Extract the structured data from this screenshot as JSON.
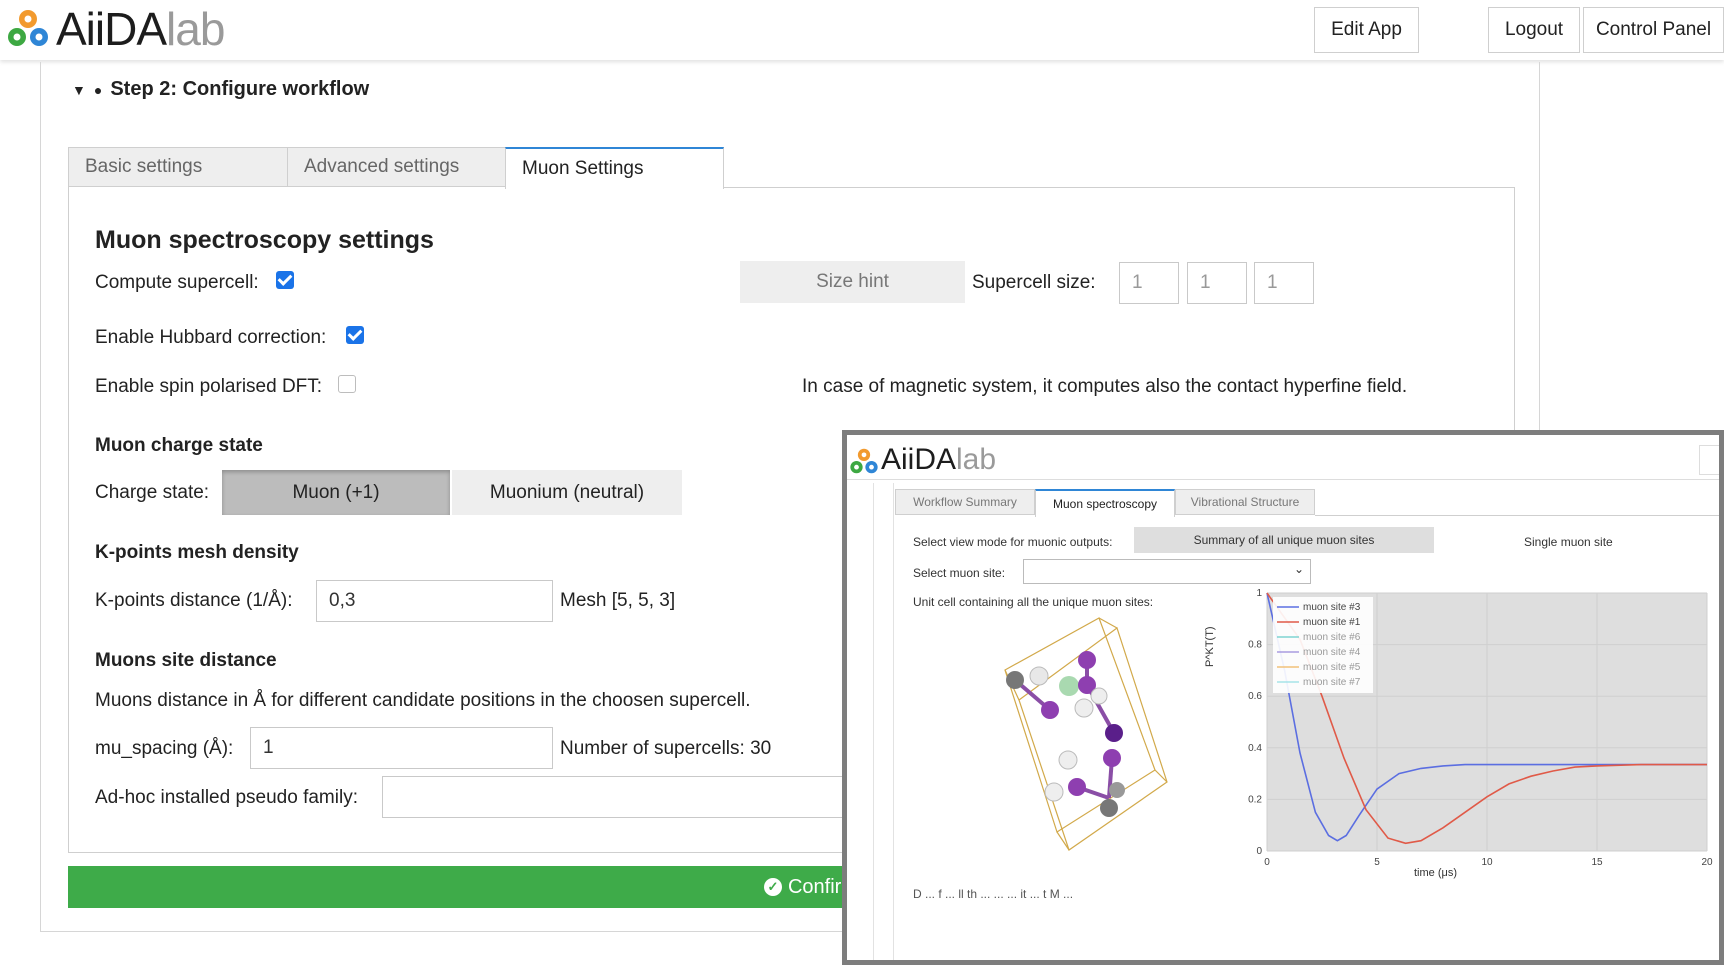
{
  "header": {
    "app_name_main": "AiiDA",
    "app_name_suffix": "lab",
    "buttons": {
      "edit_app": "Edit App",
      "logout": "Logout",
      "control_panel": "Control Panel"
    }
  },
  "step": {
    "title": "Step 2: Configure workflow"
  },
  "tabs": [
    "Basic settings",
    "Advanced settings",
    "Muon Settings"
  ],
  "muon_settings": {
    "section_title": "Muon spectroscopy settings",
    "compute_supercell_label": "Compute supercell:",
    "compute_supercell_checked": true,
    "size_hint_label": "Size hint",
    "supercell_size_label": "Supercell size:",
    "supercell_size": [
      "1",
      "1",
      "1"
    ],
    "hubbard_label": "Enable Hubbard correction:",
    "hubbard_checked": true,
    "spin_label": "Enable spin polarised DFT:",
    "spin_checked": false,
    "spin_note": "In case of magnetic system, it computes also the contact hyperfine field.",
    "charge_title": "Muon charge state",
    "charge_label": "Charge state:",
    "charge_options": [
      "Muon (+1)",
      "Muonium (neutral)"
    ],
    "charge_selected": "Muon (+1)",
    "kpoints_title": "K-points mesh density",
    "kpoints_label": "K-points distance (1/Å):",
    "kpoints_value": "0,3",
    "mesh_text": "Mesh [5, 5, 3]",
    "sites_title": "Muons site distance",
    "sites_desc": "Muons distance in Å for different candidate positions in the choosen supercell.",
    "spacing_label": "mu_spacing (Å):",
    "spacing_value": "1",
    "num_supercells": "Number of supercells: 30",
    "pseudo_label": "Ad-hoc installed pseudo family:",
    "pseudo_value": ""
  },
  "confirm_label": "Confirm",
  "colors": {
    "accent_blue": "#2f86d6",
    "confirm_green": "#3eab49",
    "checkbox_blue": "#1a73e8"
  },
  "results": {
    "app_name_main": "AiiDA",
    "app_name_suffix": "lab",
    "tabs": [
      "Workflow Summary",
      "Muon spectroscopy",
      "Vibrational Structure"
    ],
    "active_tab": "Muon spectroscopy",
    "view_mode_label": "Select view mode for muonic outputs:",
    "view_modes": [
      "Summary of all unique muon sites",
      "Single muon site"
    ],
    "muon_site_label": "Select muon site:",
    "muon_site_value": "",
    "unit_cell_label": "Unit cell containing all the unique muon sites:",
    "bottom_text": "D ... f ... ll th ... ... ... it ... t M ..."
  },
  "chart_data": {
    "type": "line",
    "xlabel": "time (μs)",
    "ylabel": "P^KT(T)",
    "xlim": [
      0,
      20
    ],
    "ylim": [
      0,
      1
    ],
    "xticks": [
      0,
      5,
      10,
      15,
      20
    ],
    "yticks": [
      0,
      0.2,
      0.4,
      0.6,
      0.8,
      1
    ],
    "legend_position": "top-left",
    "series": [
      {
        "name": "muon site #3",
        "color": "#5b6ee1",
        "x": [
          0,
          0.8,
          1.5,
          2.2,
          2.8,
          3.2,
          3.6,
          4.2,
          5,
          6,
          7,
          8,
          9,
          10,
          12,
          15,
          20
        ],
        "y": [
          1,
          0.7,
          0.38,
          0.15,
          0.06,
          0.04,
          0.06,
          0.14,
          0.24,
          0.3,
          0.32,
          0.33,
          0.335,
          0.335,
          0.335,
          0.335,
          0.335
        ]
      },
      {
        "name": "muon site #1",
        "color": "#e05a48",
        "x": [
          0,
          1.5,
          2.5,
          3.5,
          4.5,
          5.5,
          6.3,
          7,
          8,
          9,
          10,
          11,
          12,
          13,
          14,
          15,
          17,
          20
        ],
        "y": [
          1,
          0.82,
          0.6,
          0.36,
          0.16,
          0.05,
          0.03,
          0.04,
          0.09,
          0.15,
          0.21,
          0.26,
          0.29,
          0.31,
          0.325,
          0.33,
          0.335,
          0.335
        ]
      },
      {
        "name": "muon site #6",
        "color": "#7fd3d1",
        "x": [],
        "y": []
      },
      {
        "name": "muon site #4",
        "color": "#a99be0",
        "x": [],
        "y": []
      },
      {
        "name": "muon site #5",
        "color": "#f2c27a",
        "x": [],
        "y": []
      },
      {
        "name": "muon site #7",
        "color": "#a6e3e8",
        "x": [],
        "y": []
      }
    ]
  }
}
